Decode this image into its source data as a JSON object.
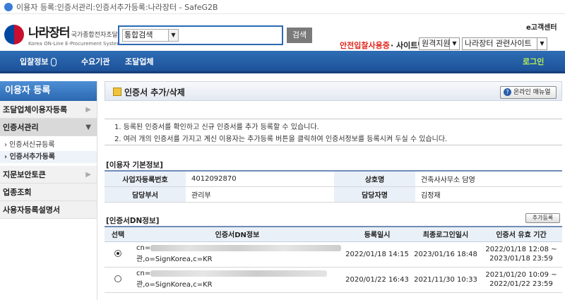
{
  "window": {
    "title": "이용자 등록:인증서관리:인증서추가등록:나라장터 - SafeG2B"
  },
  "header": {
    "logo_ko": "나라장터",
    "logo_sub": "국가종합전자조달",
    "logo_en": "Korea ON-Line E-Procurement System",
    "search_select": "통합검색",
    "search_button": "검색",
    "ecenter": "e고객센터",
    "safe_bid": "안전입찰사용중",
    "sitemap_label": "· 사이트맵",
    "sitemap_select": "원격지원",
    "related_select": "나라장터 관련사이트"
  },
  "gnb": {
    "items": [
      "입찰정보",
      "수요기관",
      "조달업체"
    ],
    "login": "로그인"
  },
  "lnb": {
    "title": "이용자 등록",
    "menu1": "조달업체이용자등록",
    "menu2": "인증서관리",
    "sub1": "› 인증서신규등록",
    "sub2": "› 인증서추가등록",
    "menu3": "지문보안토큰",
    "menu4": "업종조회",
    "menu5": "사용자등록설명서"
  },
  "page": {
    "title": "인증서 추가/삭제",
    "help_button": "온라인 매뉴얼",
    "notices": [
      "1. 등록된 인증서를 확인하고 신규 인증서를 추가 등록할 수 있습니다.",
      "2. 여러 개의 인증서를 가지고 계신 이용자는 추가등록 버튼을 클릭하여 인증서정보를 등록시켜 두실 수 있습니다."
    ],
    "basic_title": "[이용자 기본정보]",
    "basic": {
      "biz_no_label": "사업자등록번호",
      "biz_no": "4012092870",
      "company_label": "상호명",
      "company": "건축사사무소 담영",
      "dept_label": "담당부서",
      "dept": "관리부",
      "person_label": "담당자명",
      "person": "김정재"
    },
    "dn_title": "[인증서DN정보]",
    "add_button": "추가등록",
    "columns": [
      "선택",
      "인증서DN정보",
      "등록일시",
      "최종로그인일시",
      "인증서 유효 기간"
    ],
    "rows": [
      {
        "dn_prefix": "cn=",
        "dn_suffix": "관,o=SignKorea,c=KR",
        "registered": "2022/01/18 14:15",
        "last_login": "2023/01/16 18:48",
        "valid_from": "2022/01/18 12:08 ~",
        "valid_to": "2023/01/18 23:59"
      },
      {
        "dn_prefix": "cn=",
        "dn_suffix": "관,o=SignKorea,c=KR",
        "registered": "2020/01/22 16:43",
        "last_login": "2021/11/30 10:33",
        "valid_from": "2021/01/20 10:09 ~",
        "valid_to": "2022/01/22 23:59"
      }
    ]
  }
}
